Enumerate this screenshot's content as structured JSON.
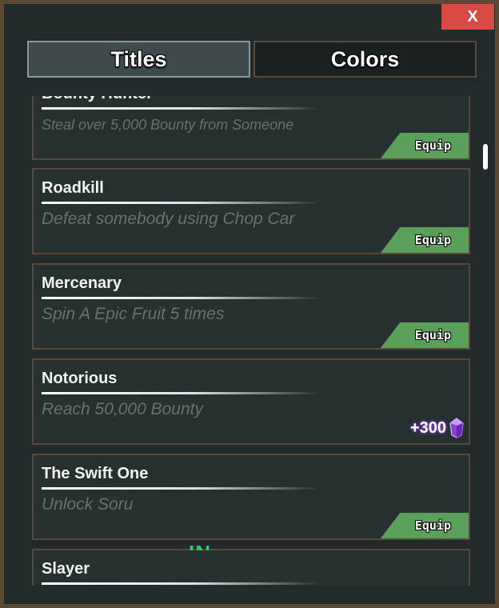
{
  "close_button": {
    "label": "X"
  },
  "tabs": [
    {
      "label": "Titles",
      "active": true
    },
    {
      "label": "Colors",
      "active": false
    }
  ],
  "titles": [
    {
      "title": "Bounty Hunter",
      "description": "Steal over 5,000 Bounty from Someone",
      "action": "Equip"
    },
    {
      "title": "Roadkill",
      "description": "Defeat somebody using Chop Car",
      "action": "Equip"
    },
    {
      "title": "Mercenary",
      "description": "Spin A Epic Fruit 5 times",
      "action": "Equip"
    },
    {
      "title": "Notorious",
      "description": "Reach 50,000 Bounty",
      "reward": "+300",
      "reward_icon": "purple-gem-icon"
    },
    {
      "title": "The Swift One",
      "description": "Unlock Soru",
      "action": "Equip"
    },
    {
      "title": "Slayer",
      "description": ""
    }
  ],
  "background_overlay_text": "IN SAFEZONE",
  "colors": {
    "panel_bg": "#232a2b",
    "card_bg": "#263031",
    "border": "#5a4a35",
    "equip_green": "#5ba05a",
    "close_red": "#d84a46",
    "safezone_green": "#31c76a"
  }
}
